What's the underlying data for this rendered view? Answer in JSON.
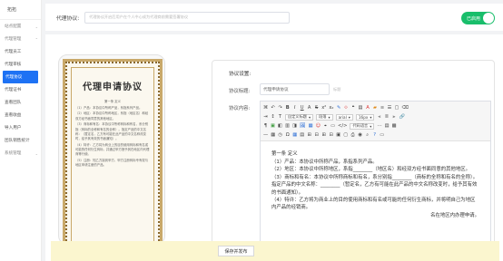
{
  "sidebar": {
    "logo": "拓拓",
    "items": [
      {
        "label": "站点配置",
        "group": true
      },
      {
        "label": "代理管理",
        "group": true
      },
      {
        "label": "代理员工"
      },
      {
        "label": "代理审核"
      },
      {
        "label": "代理协议",
        "active": true
      },
      {
        "label": "代理证书"
      },
      {
        "label": "查看团队"
      },
      {
        "label": "查看收益"
      },
      {
        "label": "导入用户"
      },
      {
        "label": "团队销售统计"
      },
      {
        "label": "系统管理",
        "group": true
      }
    ]
  },
  "topbar": {
    "label": "代理协议:",
    "placeholder": "代理协议开启后用户在个人中心成为代理商前需要签署协议",
    "toggle_label": "已启用"
  },
  "certificate": {
    "title": "代理申请协议",
    "paragraphs": [
      "第一条 定义",
      "（1）产品：本协议中所称产品，系指系列产品。",
      "（2）地区：本协议中所称地区，系指（地区名）和经双方经书面同意的其他地区。",
      "（3）商标和有名：本协议中所称商标和有名，系分别指（商标的全称和有名的全称）。指定产品的中文名称：（暂定名，乙方有可能在此产品的中文名称改变时，给予其有效的书面通知）。",
      "（4）特许：乙方将为商业上的目的使用商标和有名或可能的任何衍生商标，并通过甲方授予其在地区内代理商等行使。",
      "（5）注册：知乙方接到甲方，甲方注册商标专有权与地区申请注册的产品。"
    ]
  },
  "panel": {
    "title": "协议设置:",
    "tag_label": "协议标题:",
    "tag_value": "代理申请协议",
    "tag_hint": "标题",
    "content_label": "协议内容:",
    "font_family": "自定义标题",
    "paragraph": "段落",
    "font": "arial",
    "font_size": "16px",
    "code_lang": "代码语言",
    "doc": [
      "第一条 定义",
      "（1）产品：本协议中所称产品，系指系列产品。",
      "（2）地区：本协议中所称地区，系指________（地区名）和经双方经书面同意的其他地区。",
      "（3）商标和有名：本协议中所称商标和有名，系分别指________（商标的全称和有名的全称）。指定产品的中文名称：________（暂定名，乙方有可能在此产品的中文名称改变时，给予其有效的书面通知）。",
      "（4）特许：乙方将为商业上的目的使用商标和有名或可能的任何衍生商标，并将明自己为地区内产品的经销商。",
      "名在地区内办理申请。"
    ]
  },
  "save_button": "保存并发布",
  "colors": {
    "primary": "#1e72f4",
    "toggle_on": "#19be6b",
    "save_bar": "#fbf6cf"
  }
}
